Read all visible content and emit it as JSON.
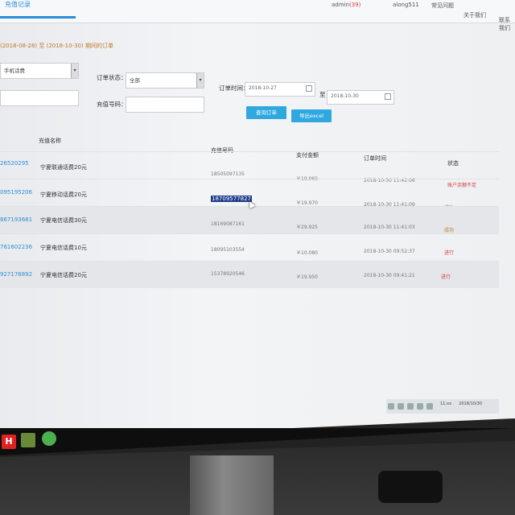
{
  "tabs": {
    "active": "充值记录"
  },
  "nav": {
    "user": "admin",
    "notice": "(39)",
    "account": "along511",
    "items": [
      "常见问题",
      "关于我们",
      "联系我们"
    ]
  },
  "crumb": "(2018-08-28) 至 (2018-10-30) 期间的订单",
  "filters": {
    "product_select": "手机话费",
    "status_label": "订单状态：",
    "status_value": "全部",
    "time_label": "订单时间：",
    "date_from": "2018-10-27",
    "date_to": "2018-10-30",
    "to_sep": "至",
    "phone_label": "充值号码：",
    "search_btn": "查询订单",
    "export_btn": "导出excel"
  },
  "table": {
    "headers": [
      "充值名称",
      "充值号码",
      "支付金额",
      "订单时间",
      "状态"
    ],
    "rows": [
      {
        "id": "26520295",
        "name": "宁夏联通话费20元",
        "phone": "18505097135",
        "amount": "￥19.960",
        "time": "2018-10-30 11:42:06",
        "status": "账户余额不足",
        "status_type": "err"
      },
      {
        "id": "095195206",
        "name": "宁夏移动话费20元",
        "phone": "18709577827",
        "amount": "￥19.970",
        "time": "2018-10-30 11:41:09",
        "status": "成功",
        "status_type": "ok"
      },
      {
        "id": "867193681",
        "name": "宁夏电信话费30元",
        "phone": "18169087161",
        "amount": "￥29.925",
        "time": "2018-10-30 11:41:03",
        "status": "成功",
        "status_type": "ok"
      },
      {
        "id": "761602236",
        "name": "宁夏电信话费10元",
        "phone": "18095103554",
        "amount": "￥10.080",
        "time": "2018-10-30 09:52:37",
        "status": "进行",
        "status_type": "err"
      },
      {
        "id": "927176892",
        "name": "宁夏电信话费20元",
        "phone": "15378920546",
        "amount": "￥19.950",
        "time": "2018-10-30 09:41:21",
        "status": "进行",
        "status_type": "err"
      }
    ]
  },
  "clock": {
    "time": "11:xx",
    "date": "2018/10/30"
  },
  "taskbar": {
    "app_letter": "H"
  }
}
